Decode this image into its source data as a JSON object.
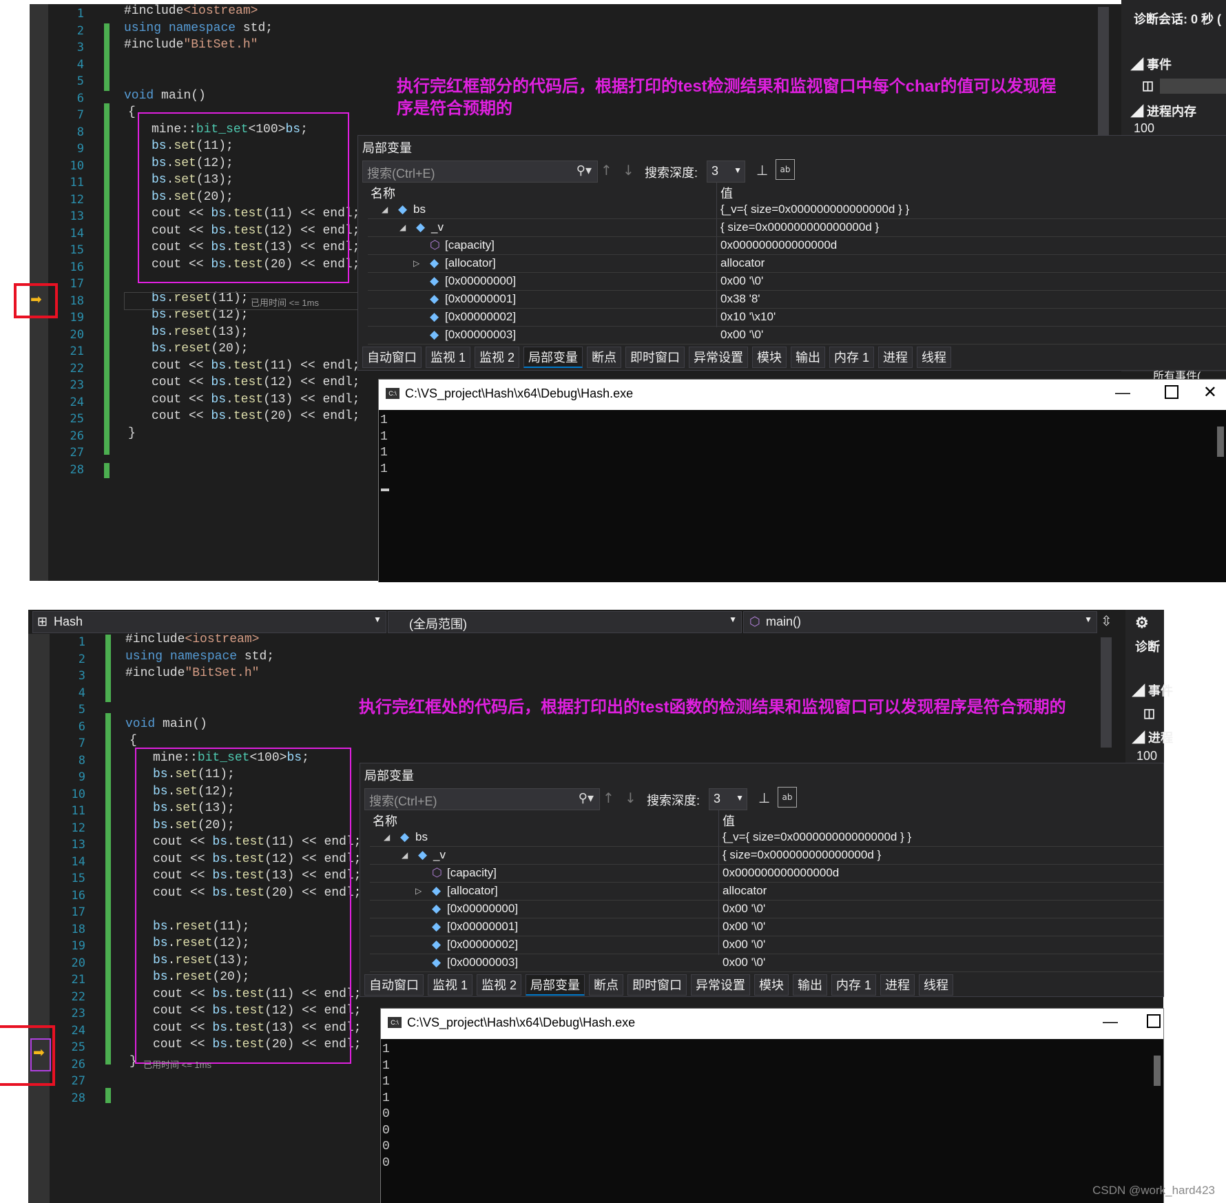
{
  "top": {
    "note": "执行完红框部分的代码后，根据打印的test检测结果和监视窗口中每个char的值可以发现程序是符合预期的",
    "elapsed": "已用时间 <= 1ms",
    "side_title": "诊断会话: 0 秒 (",
    "side_events": "事件",
    "side_memory": "进程内存",
    "side_mem_value": "100",
    "side_all_events": "所有事件(",
    "locals": {
      "title": "局部变量",
      "search_placeholder": "搜索(Ctrl+E)",
      "depth_label": "搜索深度:",
      "depth_value": "3",
      "col_name": "名称",
      "col_value": "值",
      "rows": [
        {
          "name": "bs",
          "value": "{_v={ size=0x000000000000000d } }"
        },
        {
          "name": "_v",
          "value": "{ size=0x000000000000000d }"
        },
        {
          "name": "[capacity]",
          "value": "0x000000000000000d"
        },
        {
          "name": "[allocator]",
          "value": "allocator"
        },
        {
          "name": "[0x00000000]",
          "value": "0x00 '\\0'"
        },
        {
          "name": "[0x00000001]",
          "value": "0x38 '8'"
        },
        {
          "name": "[0x00000002]",
          "value": "0x10 '\\x10'"
        },
        {
          "name": "[0x00000003]",
          "value": "0x00 '\\0'"
        }
      ]
    },
    "console": {
      "title": "C:\\VS_project\\Hash\\x64\\Debug\\Hash.exe",
      "output": "1\n1\n1\n1"
    }
  },
  "bottom": {
    "note": "执行完红框处的代码后，根据打印出的test函数的检测结果和监视窗口可以发现程序是符合预期的",
    "elapsed": "已用时间 <= 1ms",
    "project_combo": "Hash",
    "scope_combo": "(全局范围)",
    "func_combo": "main()",
    "side_title": "诊断",
    "side_events": "事件",
    "side_memory": "进程",
    "side_mem_value": "100",
    "locals": {
      "title": "局部变量",
      "search_placeholder": "搜索(Ctrl+E)",
      "depth_label": "搜索深度:",
      "depth_value": "3",
      "col_name": "名称",
      "col_value": "值",
      "rows": [
        {
          "name": "bs",
          "value": "{_v={ size=0x000000000000000d } }"
        },
        {
          "name": "_v",
          "value": "{ size=0x000000000000000d }"
        },
        {
          "name": "[capacity]",
          "value": "0x000000000000000d"
        },
        {
          "name": "[allocator]",
          "value": "allocator"
        },
        {
          "name": "[0x00000000]",
          "value": "0x00 '\\0'"
        },
        {
          "name": "[0x00000001]",
          "value": "0x00 '\\0'"
        },
        {
          "name": "[0x00000002]",
          "value": "0x00 '\\0'"
        },
        {
          "name": "[0x00000003]",
          "value": "0x00 '\\0'"
        }
      ]
    },
    "console": {
      "title": "C:\\VS_project\\Hash\\x64\\Debug\\Hash.exe",
      "output": "1\n1\n1\n1\n0\n0\n0\n0"
    }
  },
  "tabs": [
    "自动窗口",
    "监视 1",
    "监视 2",
    "局部变量",
    "断点",
    "即时窗口",
    "异常设置",
    "模块",
    "输出",
    "内存 1",
    "进程",
    "线程"
  ],
  "code_lines": [
    "#include<iostream>",
    "using namespace std;",
    "#include\"BitSet.h\"",
    "",
    "",
    "void main()",
    "{",
    "mine::bit_set<100>bs;",
    "bs.set(11);",
    "bs.set(12);",
    "bs.set(13);",
    "bs.set(20);",
    "cout << bs.test(11) << endl;",
    "cout << bs.test(12) << endl;",
    "cout << bs.test(13) << endl;",
    "cout << bs.test(20) << endl;",
    "",
    "bs.reset(11);",
    "bs.reset(12);",
    "bs.reset(13);",
    "bs.reset(20);",
    "cout << bs.test(11) << endl;",
    "cout << bs.test(12) << endl;",
    "cout << bs.test(13) << endl;",
    "cout << bs.test(20) << endl;",
    "}",
    "",
    ""
  ],
  "line_numbers": [
    "1",
    "2",
    "3",
    "4",
    "5",
    "6",
    "7",
    "8",
    "9",
    "10",
    "11",
    "12",
    "13",
    "14",
    "15",
    "16",
    "17",
    "18",
    "19",
    "20",
    "21",
    "22",
    "23",
    "24",
    "25",
    "26",
    "27",
    "28"
  ],
  "watermark": "CSDN @work_hard423",
  "colors": {
    "accent": "#e020e0",
    "breakpoint_box": "#e81123",
    "arrow": "#f5b81b",
    "line_numbers": "#2b91af"
  }
}
